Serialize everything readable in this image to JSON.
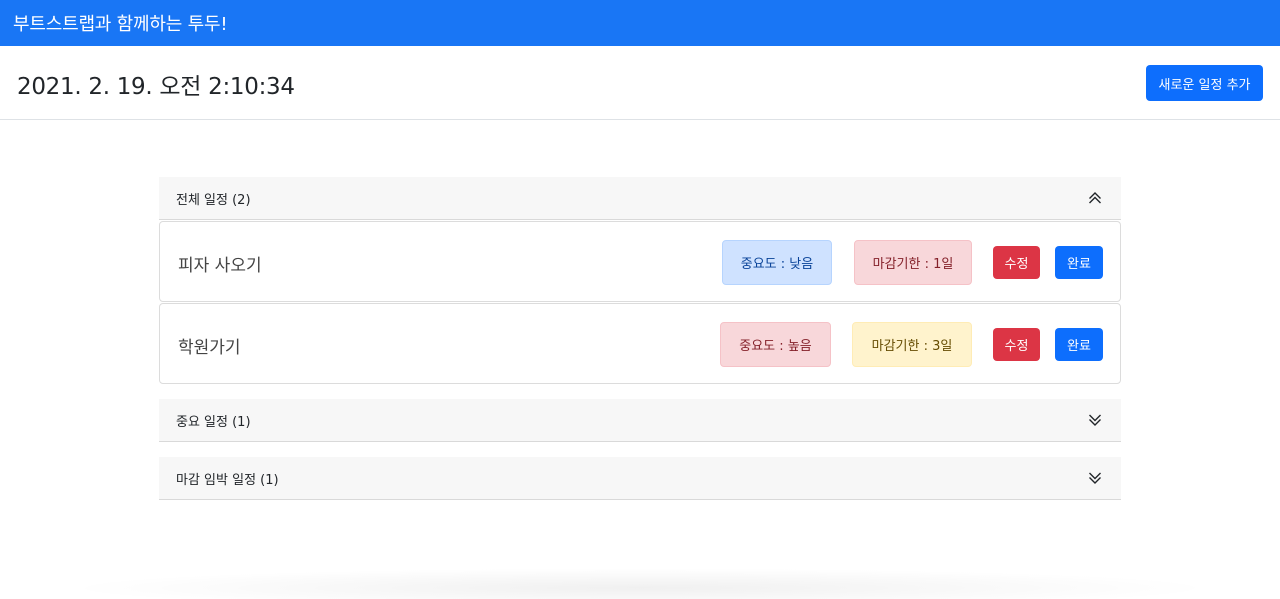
{
  "navbar": {
    "brand": "부트스트랩과 함께하는 투두!"
  },
  "header": {
    "clock": "2021. 2. 19. 오전 2:10:34",
    "add_button": "새로운 일정 추가"
  },
  "sections": [
    {
      "title": "전체 일정 (2)",
      "expanded": true,
      "todos": [
        {
          "title": "피자 사오기",
          "priority": "중요도 : 낮음",
          "deadline": "마감기한 : 1일",
          "edit": "수정",
          "done": "완료"
        },
        {
          "title": "학원가기",
          "priority": "중요도 : 높음",
          "deadline": "마감기한 : 3일",
          "edit": "수정",
          "done": "완료"
        }
      ]
    },
    {
      "title": "중요 일정 (1)",
      "expanded": false
    },
    {
      "title": "마감 임박 일정 (1)",
      "expanded": false
    }
  ],
  "colors": {
    "navbar": "#1976f5",
    "primary": "#0d6efd",
    "danger": "#dc3545"
  },
  "icons": {
    "expanded": "chevron-double-up-icon",
    "collapsed": "chevron-double-down-icon"
  }
}
